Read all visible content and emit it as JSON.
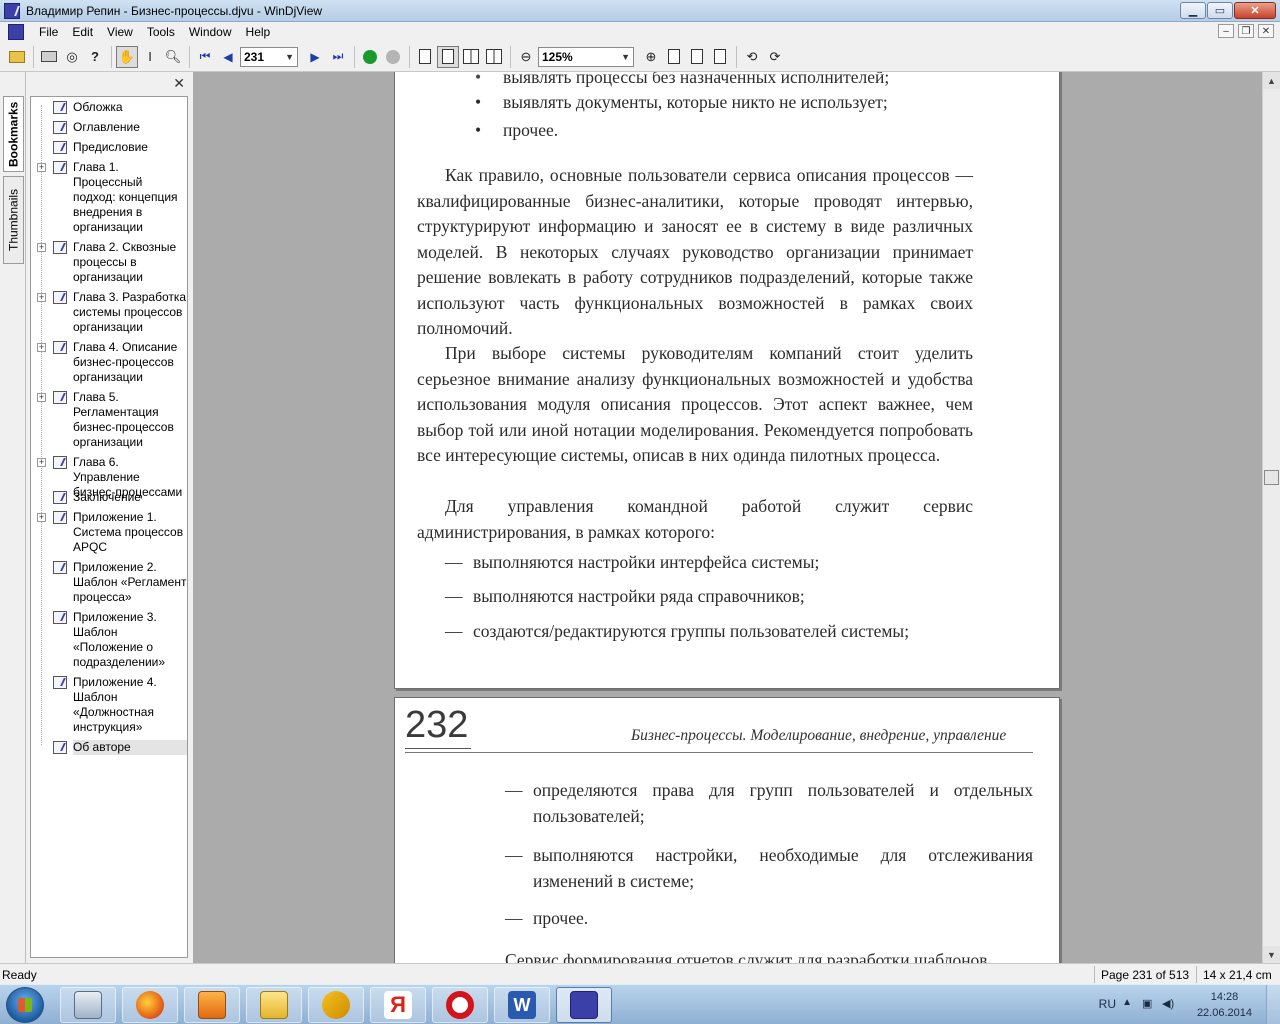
{
  "window": {
    "title": "Владимир Репин - Бизнес-процессы.djvu - WinDjView",
    "minimize": "▁",
    "maximize": "▭",
    "close": "✕"
  },
  "menu": {
    "items": [
      "File",
      "Edit",
      "View",
      "Tools",
      "Window",
      "Help"
    ],
    "mdi_minimize": "–",
    "mdi_restore": "❐",
    "mdi_close": "✕"
  },
  "toolbar": {
    "page_value": "231",
    "zoom_value": "125%",
    "icons": [
      "open-icon",
      "print-icon",
      "find-icon",
      "help-icon",
      "hand-tool-icon",
      "select-tool-icon",
      "zoom-tool-icon",
      "first-page-icon",
      "prev-page-icon",
      "next-page-icon",
      "last-page-icon",
      "back-icon",
      "forward-icon",
      "single-page-icon",
      "continuous-icon",
      "facing-icon",
      "continuous-facing-icon",
      "zoom-out-icon",
      "zoom-in-icon",
      "fit-page-icon",
      "fit-width-icon",
      "actual-size-icon",
      "rotate-left-icon",
      "rotate-right-icon"
    ]
  },
  "sidebar": {
    "tabs": [
      "Bookmarks",
      "Thumbnails"
    ],
    "close": "✕",
    "bookmarks": [
      {
        "label": "Обложка",
        "expandable": false
      },
      {
        "label": "Оглавление",
        "expandable": false
      },
      {
        "label": "Предисловие",
        "expandable": false
      },
      {
        "label": "Глава 1.\nПроцессный\nподход: концепция\nвнедрения в\nорганизации",
        "expandable": true
      },
      {
        "label": "Глава 2. Сквозные\nпроцессы в\nорганизации",
        "expandable": true
      },
      {
        "label": "Глава 3. Разработка\nсистемы процессов\nорганизации",
        "expandable": true
      },
      {
        "label": "Глава 4. Описание\nбизнес-процессов\nорганизации",
        "expandable": true
      },
      {
        "label": "Глава 5.\nРегламентация\nбизнес-процессов\nорганизации",
        "expandable": true
      },
      {
        "label": "Глава 6. Управление\nбизнес-процессами",
        "expandable": true
      },
      {
        "label": "Заключение",
        "expandable": false
      },
      {
        "label": "Приложение 1.\nСистема процессов\nAPQC",
        "expandable": true
      },
      {
        "label": "Приложение 2.\nШаблон «Регламент\nпроцесса»",
        "expandable": false
      },
      {
        "label": "Приложение 3.\nШаблон\n«Положение о\nподразделении»",
        "expandable": false
      },
      {
        "label": "Приложение 4.\nШаблон\n«Должностная\nинструкция»",
        "expandable": false
      },
      {
        "label": "Об авторе",
        "expandable": false
      }
    ]
  },
  "document": {
    "page231": {
      "cut_bullet": "выявлять процессы без назначенных исполнителей;",
      "bullet1": "выявлять документы, которые никто не использует;",
      "bullet2": "прочее.",
      "bullet_mark": "•",
      "para1": "Как правило, основные пользователи сервиса описания процессов — квалифицированные бизнес-аналитики, которые проводят интервью, структурируют информацию и заносят ее в систему в виде различных моделей. В некоторых случаях руководство организации принимает решение вовлекать в работу сотрудников подразделений, которые также используют часть функциональных возможностей в рамках своих полномочий.",
      "para2": "При выборе системы руководителям компаний стоит уделить серьезное внимание анализу функциональных возможностей и удобства использования модуля описания процессов. Этот аспект важнее, чем выбор той или иной нотации моделирования. Рекомендуется попробовать все интересующие системы, описав в них одинда пилотных процесса.",
      "para3": "Для управления командной работой служит сервис администрирования, в рамках которого:",
      "dash": "—",
      "dash1": "выполняются настройки интерфейса системы;",
      "dash2": "выполняются настройки ряда справочников;",
      "dash3": "создаются/редактируются группы пользователей системы;"
    },
    "page232": {
      "number": "232",
      "running_head": "Бизнес-процессы. Моделирование, внедрение, управление",
      "dash": "—",
      "item1": "определяются права для групп пользователей и отдельных пользователей;",
      "item2": "выполняются настройки, необходимые для отслеживания изменений в системе;",
      "item3": "прочее.",
      "cut_para": "Сервис формирования отчетов служит для разработки шаблонов"
    }
  },
  "statusbar": {
    "ready": "Ready",
    "page": "Page 231 of 513",
    "size": "14 x 21,4 cm"
  },
  "taskbar": {
    "lang": "RU",
    "time": "14:28",
    "date": "22.06.2014",
    "apps": [
      "explorer-icon",
      "firefox-icon",
      "media-player-icon",
      "folder-icon",
      "tools-icon",
      "yandex-icon",
      "opera-icon",
      "word-icon",
      "windjview-icon"
    ],
    "yandex_letter": "Я",
    "word_letter": "W"
  }
}
